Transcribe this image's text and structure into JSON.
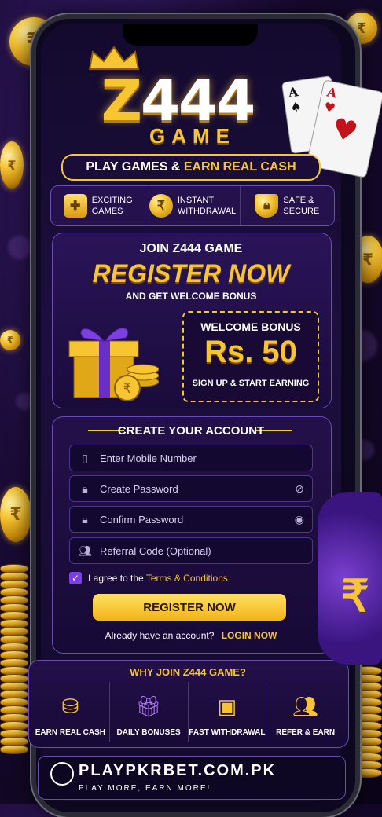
{
  "brand": {
    "logo_z": "Z",
    "logo_num": "444",
    "game": "GAME",
    "tagline_white": "PLAY GAMES & ",
    "tagline_gold": "EARN REAL CASH"
  },
  "features": [
    {
      "icon": "gamepad-icon",
      "label1": "EXCITING",
      "label2": "GAMES"
    },
    {
      "icon": "rupee-coin-icon",
      "label1": "INSTANT",
      "label2": "WITHDRAWAL"
    },
    {
      "icon": "shield-lock-icon",
      "label1": "SAFE &",
      "label2": "SECURE"
    }
  ],
  "promo": {
    "join": "JOIN Z444 GAME",
    "register": "REGISTER NOW",
    "sub": "AND GET WELCOME BONUS",
    "bonus_title": "WELCOME BONUS",
    "bonus_amount": "Rs. 50",
    "bonus_sub": "SIGN UP & START EARNING"
  },
  "form": {
    "title": "CREATE YOUR ACCOUNT",
    "fields": [
      {
        "placeholder": "Enter Mobile Number",
        "icon": "phone-icon"
      },
      {
        "placeholder": "Create Password",
        "icon": "lock-icon",
        "trailing": "eye-off-icon"
      },
      {
        "placeholder": "Confirm Password",
        "icon": "lock-icon",
        "trailing": "eye-icon"
      },
      {
        "placeholder": "Referral Code (Optional)",
        "icon": "users-icon"
      }
    ],
    "agree_prefix": "I agree to the ",
    "agree_link": "Terms & Conditions",
    "agree_checked": true,
    "submit": "REGISTER NOW",
    "already": "Already have an account?",
    "login": "LOGIN NOW"
  },
  "why": {
    "title": "WHY JOIN Z444 GAME?",
    "items": [
      {
        "icon": "coin-stack-icon",
        "label": "EARN REAL CASH"
      },
      {
        "icon": "gift-icon",
        "label": "DAILY BONUSES"
      },
      {
        "icon": "wallet-icon",
        "label": "FAST WITHDRAWAL"
      },
      {
        "icon": "group-icon",
        "label": "REFER & EARN"
      }
    ]
  },
  "footer": {
    "url": "PLAYPKRBET.COM.PK",
    "slogan": "PLAY MORE, EARN MORE!"
  },
  "colors": {
    "accent": "#f6c531",
    "purple": "#7b3fe4",
    "bg": "#140a2e"
  }
}
